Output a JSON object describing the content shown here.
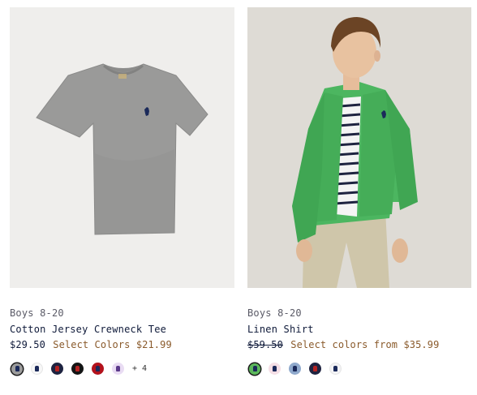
{
  "products": [
    {
      "category": "Boys 8-20",
      "name": "Cotton Jersey Crewneck Tee",
      "price": "$29.50",
      "sale_text": "Select Colors $21.99",
      "swatches": [
        {
          "name": "gray",
          "color": "#9c9c9c",
          "pony": "#1b2a5a",
          "selected": true
        },
        {
          "name": "white",
          "color": "#f7f7f7",
          "pony": "#1b2a5a"
        },
        {
          "name": "navy",
          "color": "#1e2340",
          "pony": "#b22222"
        },
        {
          "name": "black",
          "color": "#141414",
          "pony": "#b22222"
        },
        {
          "name": "red",
          "color": "#b3121c",
          "pony": "#1b2a5a"
        },
        {
          "name": "lavender",
          "color": "#e9dcf3",
          "pony": "#5b3a8a"
        }
      ],
      "more_label": "+ 4"
    },
    {
      "category": "Boys 8-20",
      "name": "Linen Shirt",
      "price": "$59.50",
      "sale_text": "Select colors from $35.99",
      "swatches": [
        {
          "name": "green",
          "color": "#5cb85c",
          "pony": "#1b2a5a",
          "selected": true
        },
        {
          "name": "pink",
          "color": "#f5dfe6",
          "pony": "#1b2a5a"
        },
        {
          "name": "blue",
          "color": "#8fa9cc",
          "pony": "#1b2a5a"
        },
        {
          "name": "navy",
          "color": "#1e2340",
          "pony": "#b22222"
        },
        {
          "name": "white",
          "color": "#f3f3f5",
          "pony": "#1b2a5a"
        }
      ]
    }
  ]
}
